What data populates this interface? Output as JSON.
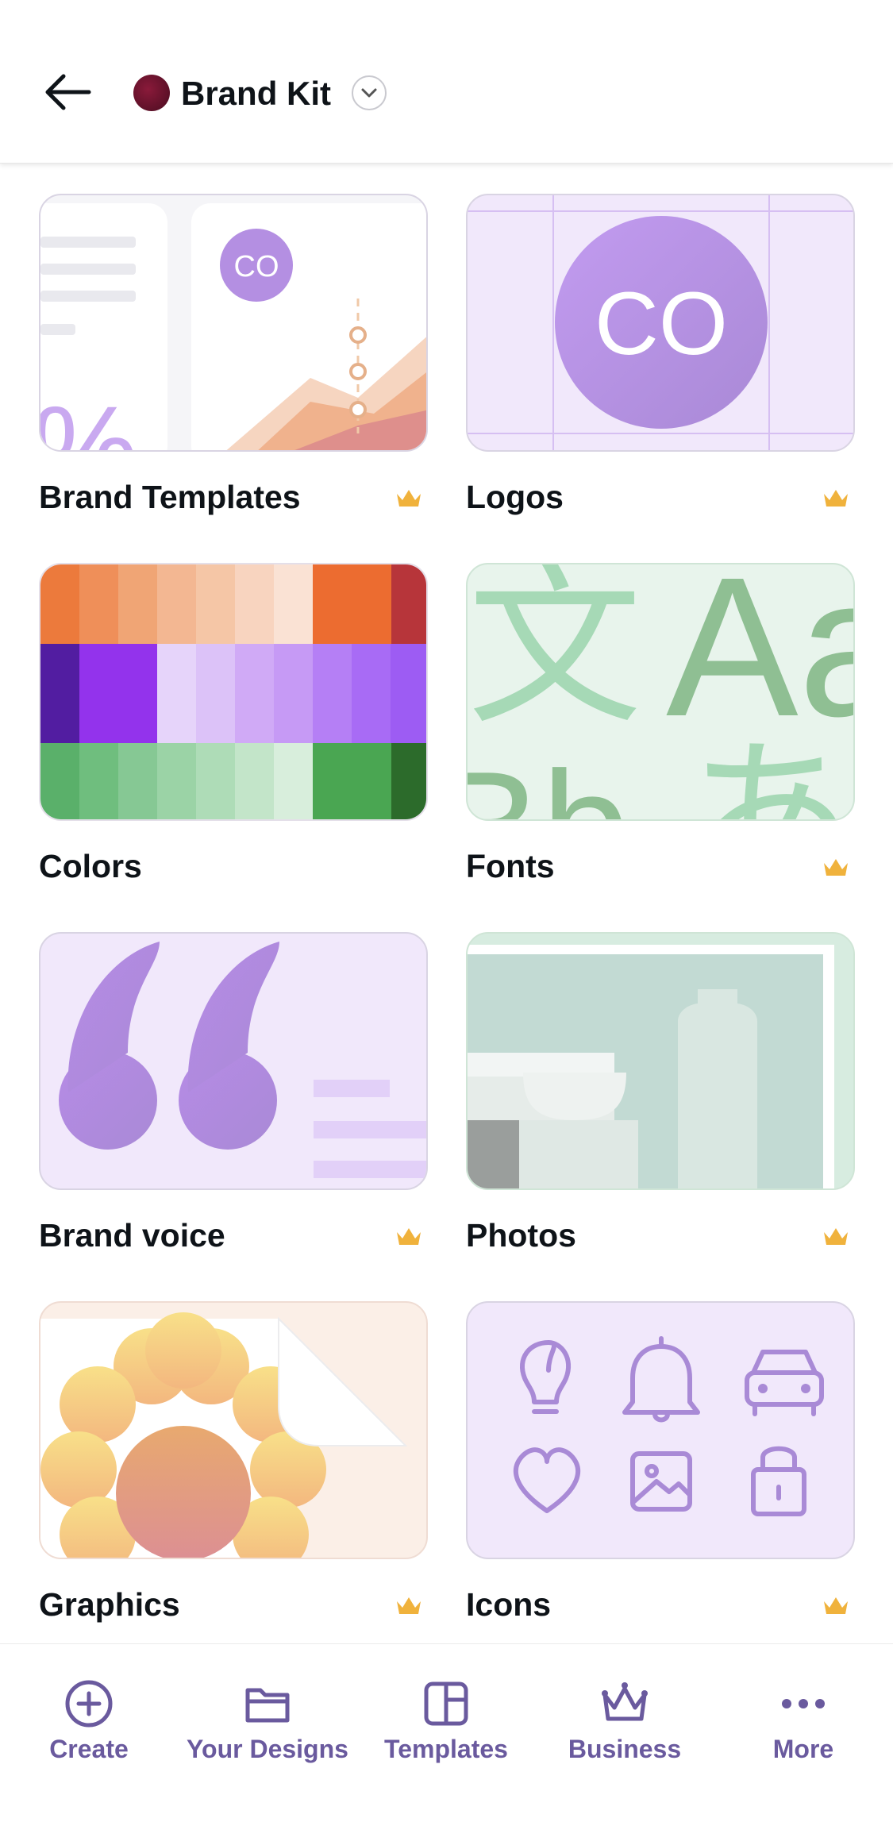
{
  "header": {
    "title": "Brand Kit"
  },
  "cards": [
    {
      "label": "Brand Templates",
      "premium": true
    },
    {
      "label": "Logos",
      "premium": true,
      "logo_text": "CO"
    },
    {
      "label": "Colors",
      "premium": false
    },
    {
      "label": "Fonts",
      "premium": true
    },
    {
      "label": "Brand voice",
      "premium": true
    },
    {
      "label": "Photos",
      "premium": true
    },
    {
      "label": "Graphics",
      "premium": true
    },
    {
      "label": "Icons",
      "premium": true
    }
  ],
  "template_preview": {
    "badge_text": "CO",
    "percent_text": "%"
  },
  "fonts_preview": {
    "glyphs": [
      "文",
      "Aa",
      "Bb",
      "あ"
    ]
  },
  "nav": {
    "items": [
      {
        "label": "Create",
        "icon": "plus-circle-icon"
      },
      {
        "label": "Your Designs",
        "icon": "folder-icon"
      },
      {
        "label": "Templates",
        "icon": "templates-icon"
      },
      {
        "label": "Business",
        "icon": "crown-icon"
      },
      {
        "label": "More",
        "icon": "more-dots-icon"
      }
    ]
  },
  "colors": {
    "crown": "#f0b23c",
    "nav_icon": "#6a5a9e",
    "purple_tint": "#f1e8fb",
    "purple_circle": "#b48fe2",
    "green_tint": "#e8f4ec"
  }
}
